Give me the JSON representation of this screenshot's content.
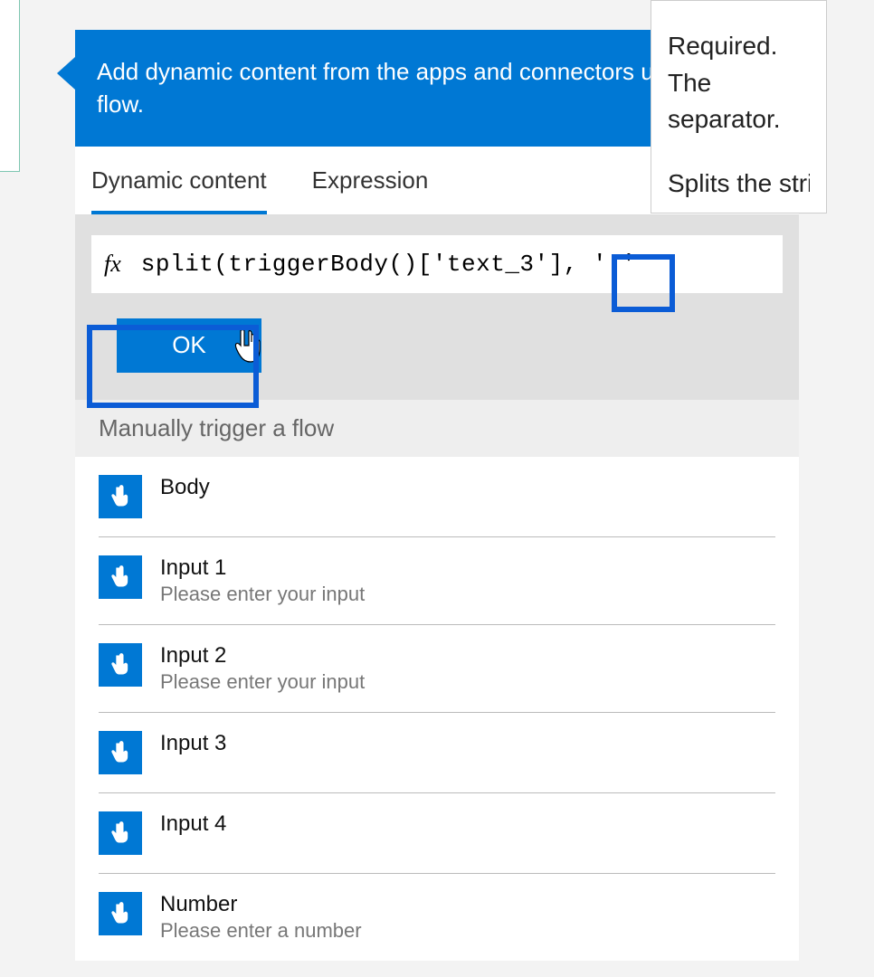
{
  "header": {
    "description": "Add dynamic content from the apps and connectors used in this flow."
  },
  "tabs": [
    {
      "label": "Dynamic content",
      "active": true
    },
    {
      "label": "Expression",
      "active": false
    }
  ],
  "expression": {
    "fx_label": "fx",
    "value": "split(triggerBody()['text_3'], ' '"
  },
  "ok_button": {
    "label": "OK"
  },
  "tooltip": {
    "primary": "Required. The separator.",
    "secondary": "Splits the string using"
  },
  "section": {
    "title": "Manually trigger a flow"
  },
  "items": [
    {
      "title": "Body",
      "subtitle": ""
    },
    {
      "title": "Input 1",
      "subtitle": "Please enter your input"
    },
    {
      "title": "Input 2",
      "subtitle": "Please enter your input"
    },
    {
      "title": "Input 3",
      "subtitle": ""
    },
    {
      "title": "Input 4",
      "subtitle": ""
    },
    {
      "title": "Number",
      "subtitle": "Please enter a number"
    }
  ],
  "colors": {
    "accent": "#0078d4",
    "highlight": "#0b5cd6"
  }
}
